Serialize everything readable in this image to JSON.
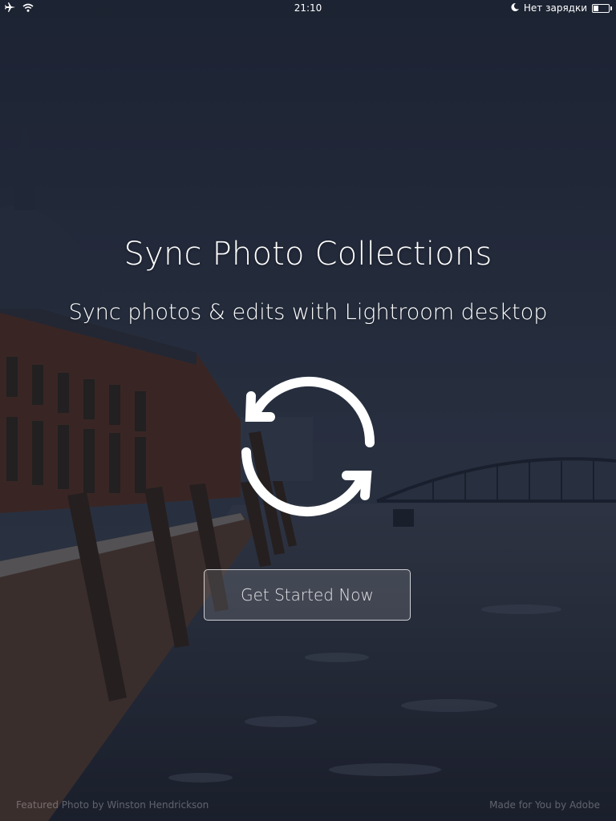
{
  "status_bar": {
    "time": "21:10",
    "carrier_status": "Нет зарядки",
    "icons": [
      "airplane-icon",
      "wifi-icon",
      "moon-icon",
      "battery-icon"
    ],
    "battery_level": 0.35
  },
  "main": {
    "title": "Sync Photo Collections",
    "subtitle": "Sync photos & edits with Lightroom desktop",
    "icon": "sync-icon",
    "cta_label": "Get Started Now"
  },
  "footer": {
    "credit": "Featured Photo by Winston Hendrickson",
    "tagline": "Made for You by Adobe"
  },
  "colors": {
    "text": "#ffffff",
    "background": "#2b3344"
  }
}
